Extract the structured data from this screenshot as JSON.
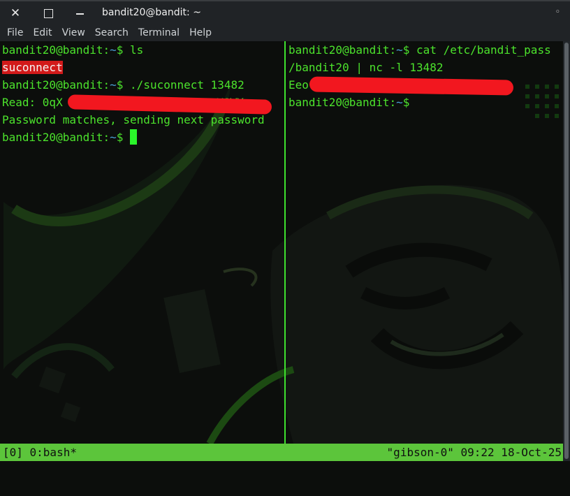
{
  "window": {
    "title": "bandit20@bandit: ~",
    "close_glyph": "✕",
    "right_glyph": "◦"
  },
  "menu": [
    "File",
    "Edit",
    "View",
    "Search",
    "Terminal",
    "Help"
  ],
  "left_pane": {
    "prompt_user": "bandit20@bandit",
    "prompt_sep": ":",
    "prompt_dir": "~",
    "prompt_symbol": "$ ",
    "cmd1": "ls",
    "out1": "suconnect",
    "cmd2": "./suconnect 13482",
    "out2_prefix": "Read: 0qX",
    "out2_suffix": "C6Z Y8WY",
    "out3": "Password matches, sending next password"
  },
  "right_pane": {
    "prompt_user": "bandit20@bandit",
    "prompt_sep": ":",
    "prompt_dir": "~",
    "prompt_symbol": "$ ",
    "cmd1_part1": "cat /etc/bandit_pass",
    "cmd1_part2": "/bandit20 | nc -l 13482",
    "out1_prefix": "Eeo"
  },
  "status_bar": {
    "left": "[0] 0:bash*",
    "right": "\"gibson-0\" 09:22 18-Oct-25"
  },
  "colors": {
    "terminal_text": "#4ce32c",
    "prompt_dir": "#4aa0d6",
    "highlight_bg": "#d21a1a",
    "redaction": "#f2171f",
    "status_bg": "#5cc53b",
    "divider": "#3ee12e"
  }
}
